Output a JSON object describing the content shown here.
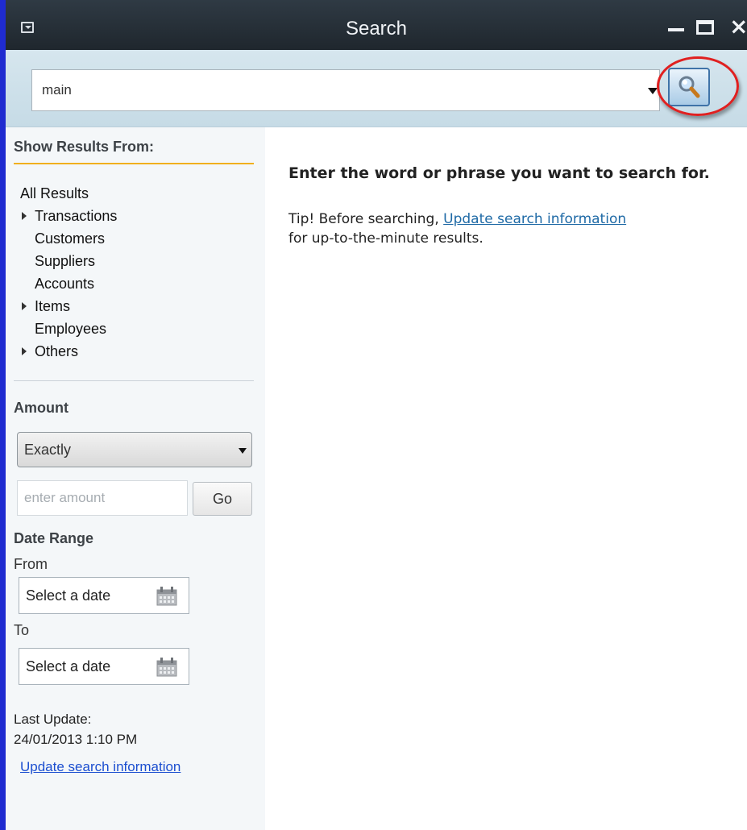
{
  "window": {
    "title": "Search"
  },
  "search": {
    "query": "main"
  },
  "sidebar": {
    "show_results_title": "Show Results From:",
    "filters": [
      {
        "label": "All Results",
        "expandable": false,
        "root": true
      },
      {
        "label": "Transactions",
        "expandable": true
      },
      {
        "label": "Customers",
        "expandable": false
      },
      {
        "label": "Suppliers",
        "expandable": false
      },
      {
        "label": "Accounts",
        "expandable": false
      },
      {
        "label": "Items",
        "expandable": true
      },
      {
        "label": "Employees",
        "expandable": false
      },
      {
        "label": "Others",
        "expandable": true
      }
    ],
    "amount_title": "Amount",
    "amount_mode": "Exactly",
    "amount_placeholder": "enter amount",
    "go_label": "Go",
    "date_range_title": "Date Range",
    "from_label": "From",
    "to_label": "To",
    "from_placeholder": "Select a date",
    "to_placeholder": "Select a date",
    "last_update_label": "Last Update:",
    "last_update_value": "24/01/2013 1:10 PM",
    "update_link": "Update search information"
  },
  "main": {
    "heading": "Enter the word or phrase you want to search for.",
    "tip_prefix": "Tip! Before searching, ",
    "tip_link": "Update search information",
    "tip_suffix": "for up-to-the-minute results."
  },
  "colors": {
    "accent_rule": "#f0b01d",
    "highlight_ring": "#e02020",
    "link": "#1f6aa6"
  }
}
